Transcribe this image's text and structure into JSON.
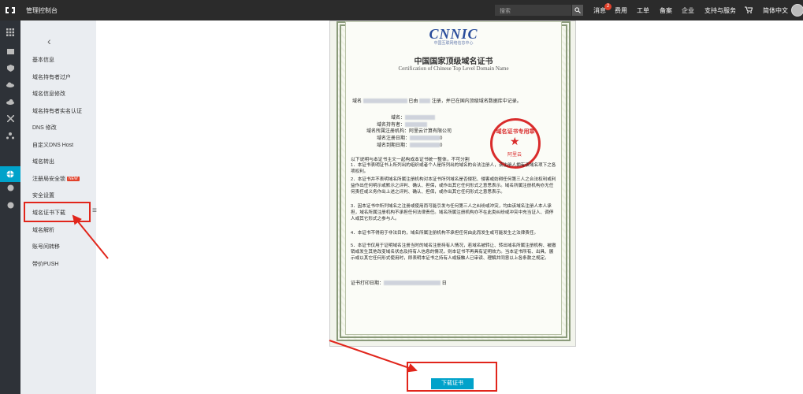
{
  "topbar": {
    "title": "管理控制台",
    "search_placeholder": "搜索",
    "nav": [
      "消息",
      "费用",
      "工单",
      "备案",
      "企业",
      "支持与服务",
      "简体中文"
    ],
    "message_count": "2"
  },
  "sidebar": {
    "items": [
      {
        "label": "基本信息"
      },
      {
        "label": "域名持有者过户"
      },
      {
        "label": "域名信息修改"
      },
      {
        "label": "域名持有者实名认证"
      },
      {
        "label": "DNS 修改"
      },
      {
        "label": "自定义DNS Host"
      },
      {
        "label": "域名转出"
      },
      {
        "label": "注册局安全锁",
        "badge": "NEW"
      },
      {
        "label": "安全设置"
      },
      {
        "label": "域名证书下载"
      },
      {
        "label": "域名解析"
      },
      {
        "label": "账号间转移"
      },
      {
        "label": "带价PUSH"
      }
    ]
  },
  "certificate": {
    "logo": "CNNIC",
    "logo_sub": "中国互联网络信息中心",
    "title": "中国国家顶级域名证书",
    "subtitle": "Certification of Chinese Top Level Domain Name",
    "line1a": "域名",
    "line1b": "已由",
    "line1c": "注册，并已在国内顶级域名数据库中记录。",
    "holder_label": "域名持有者：",
    "registrar": "域名所属注册机构：阿里云计算有限公司",
    "reg_date_label": "域名注册日期：",
    "reg_date_tail": "0",
    "exp_date_label": "域名到期日期：",
    "exp_date_tail": "0",
    "seal_text": "域名证书专用章",
    "seal_brand": "阿里云",
    "notice": "以下说明与本证书主文一起构成本证书统一整体，不可分割",
    "terms": [
      "1．本证书表明证书上所列出的组织或者个人是所列出的域名的合法注册人，该注册人拥有该域名项下之各项权利。",
      "2．本证书并不表明域名所属注册机构对本证书所列域名是否侵犯、侵害或妨碍任何第三人之合法权利或利益作出任何明示或默示之评判、确认、担保，或作出其它任何形式之意思表示。域名所属注册机构亦无任何责任或义务作出上述之评判、确认、担保，或作出其它任何形式之意思表示。",
      "3．因本证书中所列域名之注册或使用而可能引发与任何第三人之纠纷或冲突，均由该域名注册人本人承担，域名所属注册机构不承担任何法律责任。域名所属注册机构亦不在此类纠纷或冲突中充当证人、调停人或其它形式之参与人。",
      "4．本证书不得用于非法目的，域名所属注册机构不承担任何由此而发生或可能发生之法律责任。",
      "5．本证书仅用于证明域名注册当时的域名注册持有人情况，若域名被转让、转出域名所属注册机构、被撤销或发生其他改变域名状态及持有人信息的情况，则本证书不再具有证明效力。当本证书所有、出具、展示或以其它任何形式使用时，即表明本证书之持有人或接触人已审读、理解并同意以上各条款之规定。"
    ],
    "print_date_label": "证书打印日期：",
    "print_date_tail": "日"
  },
  "download": {
    "label": "下载证书"
  },
  "colors": {
    "accent": "#00a2ca",
    "highlight": "#e1251b",
    "topbar": "#2b2b2b",
    "sidebar": "#eaedf1"
  }
}
